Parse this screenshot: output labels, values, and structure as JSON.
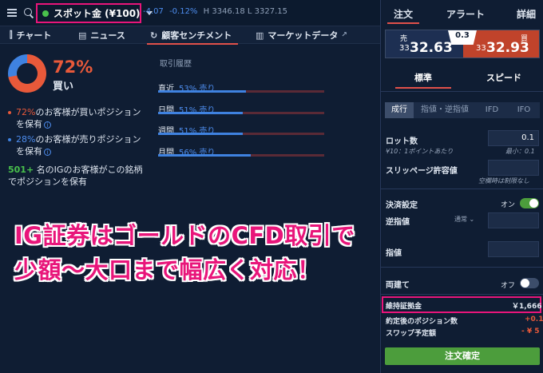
{
  "topbar": {
    "instrument": "スポット金 (¥100)",
    "change_abs": "-4.07",
    "change_pct": "-0.12%",
    "high": "H 3346.18",
    "low": "L 3327.15"
  },
  "tabs": {
    "chart": "チャート",
    "news": "ニュース",
    "sentiment": "顧客センチメント",
    "market_data": "マーケットデータ"
  },
  "sentiment": {
    "buy_pct": "72%",
    "buy_label": "買い",
    "buy_pct_value": 72,
    "line1_pct": "72%",
    "line1_text": "のお客様が買いポジション",
    "line1_cont": "を保有",
    "line2_pct": "28%",
    "line2_text": "のお客様が売りポジション",
    "line2_cont": "を保有",
    "line3_count": "501+",
    "line3_text": "名のIGのお客様がこの銘柄",
    "line3_cont": "でポジションを保有",
    "colors": {
      "buy": "#e8593a",
      "sell": "#3f82e0"
    }
  },
  "history": {
    "title": "取引履歴",
    "rows": [
      {
        "label": "直近",
        "value": "53% 売り",
        "sell_fraction": 0.53
      },
      {
        "label": "日間",
        "value": "51% 売り",
        "sell_fraction": 0.51
      },
      {
        "label": "週間",
        "value": "51% 売り",
        "sell_fraction": 0.51
      },
      {
        "label": "月間",
        "value": "56% 売り",
        "sell_fraction": 0.56
      }
    ]
  },
  "headline": {
    "line1": "IG証券はゴールドのCFD取引で",
    "line2": "少額～大口まで幅広く対応！"
  },
  "panel": {
    "tab_order": "注文",
    "tab_alert": "アラート",
    "tab_detail": "詳細",
    "sell_label": "売",
    "sell_small": "33",
    "sell_big": "32.63",
    "spread": "0.3",
    "buy_label": "買",
    "buy_small": "33",
    "buy_big": "32.93",
    "mode_standard": "標準",
    "mode_speed": "スピード",
    "order_types": [
      "成行",
      "指値・逆指値",
      "IFD",
      "IFO"
    ],
    "lot_label": "ロット数",
    "lot_value": "0.1",
    "lot_note": "¥10：1ポイントあたり",
    "lot_min": "最小：0.1",
    "slip_label": "スリッページ許容値",
    "slip_note": "空欄時は制限なし",
    "settle_label": "決済設定",
    "settle_state": "オン",
    "stop_label": "逆指値",
    "stop_mode": "通常",
    "limit_label": "指値",
    "both_label": "両建て",
    "both_state": "オフ",
    "margin_label": "維持証拠金",
    "margin_value": "￥1,666",
    "after_label": "約定後のポジション数",
    "after_value": "+0.1",
    "swap_label": "スワップ予定額",
    "swap_value": "- ¥ 5",
    "confirm": "注文確定"
  }
}
